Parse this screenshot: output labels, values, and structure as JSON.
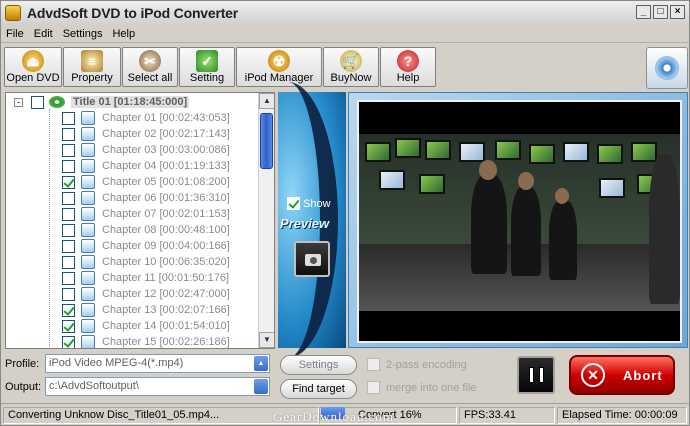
{
  "window": {
    "title": "AdvdSoft DVD to iPod Converter",
    "controls": [
      "_",
      "□",
      "×"
    ]
  },
  "menu": [
    "File",
    "Edit",
    "Settings",
    "Help"
  ],
  "toolbar": [
    {
      "label": "Open DVD",
      "icon": "open-dvd-icon"
    },
    {
      "label": "Property",
      "icon": "property-icon"
    },
    {
      "label": "Select all",
      "icon": "select-all-icon"
    },
    {
      "label": "Setting",
      "icon": "setting-icon"
    },
    {
      "label": "iPod Manager",
      "icon": "ipod-manager-icon"
    },
    {
      "label": "BuyNow",
      "icon": "buynow-icon"
    },
    {
      "label": "Help",
      "icon": "help-icon"
    }
  ],
  "tree": {
    "root": {
      "label": "Title 01 [01:18:45:000]",
      "expander": "-",
      "checked": false
    },
    "chapters": [
      {
        "label": "Chapter 01 [00:02:43:053]",
        "checked": false
      },
      {
        "label": "Chapter 02 [00:02:17:143]",
        "checked": false
      },
      {
        "label": "Chapter 03 [00:03:00:086]",
        "checked": false
      },
      {
        "label": "Chapter 04 [00:01:19:133]",
        "checked": false
      },
      {
        "label": "Chapter 05 [00:01:08:200]",
        "checked": true
      },
      {
        "label": "Chapter 06 [00:01:36:310]",
        "checked": false
      },
      {
        "label": "Chapter 07 [00:02:01:153]",
        "checked": false
      },
      {
        "label": "Chapter 08 [00:00:48:100]",
        "checked": false
      },
      {
        "label": "Chapter 09 [00:04:00:166]",
        "checked": false
      },
      {
        "label": "Chapter 10 [00:06:35:020]",
        "checked": false
      },
      {
        "label": "Chapter 11 [00:01:50:176]",
        "checked": false
      },
      {
        "label": "Chapter 12 [00:02:47:000]",
        "checked": false
      },
      {
        "label": "Chapter 13 [00:02:07:166]",
        "checked": true
      },
      {
        "label": "Chapter 14 [00:01:54:010]",
        "checked": true
      },
      {
        "label": "Chapter 15 [00:02:26:186]",
        "checked": true
      }
    ]
  },
  "preview": {
    "show_label": "Show",
    "show_checked": true,
    "title": "Preview"
  },
  "profile": {
    "label": "Profile:",
    "value": "iPod Video MPEG-4(*.mp4)"
  },
  "output": {
    "label": "Output:",
    "value": "c:\\AdvdSoftoutput\\"
  },
  "buttons": {
    "settings": "Settings",
    "find_target": "Find target",
    "abort": "Abort"
  },
  "options": {
    "two_pass": "2-pass encoding",
    "merge": "merge into one file"
  },
  "status": {
    "message": "Converting Unknow Disc_Title01_05.mp4...",
    "convert": "Convert 16%",
    "fps": "FPS:33.41",
    "elapsed": "Elapsed Time: 00:00:09",
    "progress": 0.16
  },
  "watermark": "GearDownload.com",
  "colors": {
    "accent": "#2a5ad0",
    "abort": "#d00000",
    "check": "#21a121"
  }
}
